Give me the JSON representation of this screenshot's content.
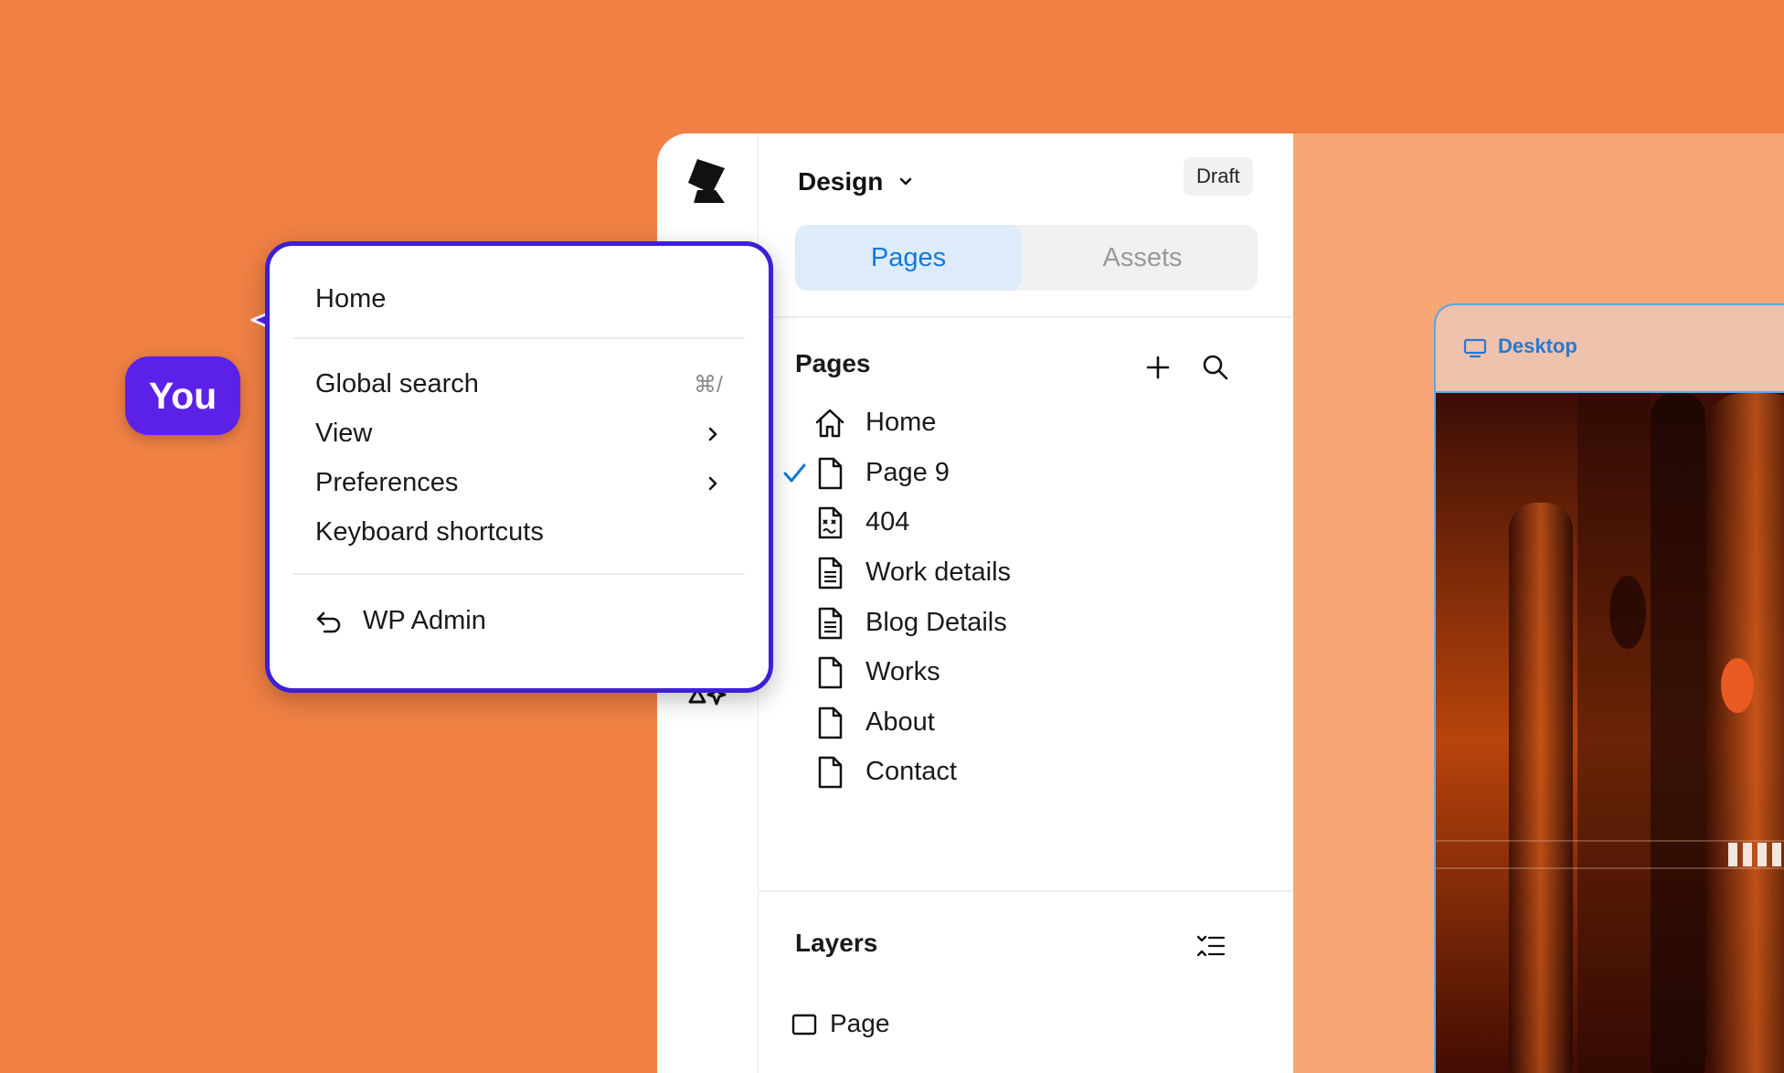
{
  "cursor": {
    "label": "You"
  },
  "menu": {
    "home": "Home",
    "global_search": "Global search",
    "global_search_shortcut": "⌘/",
    "view": "View",
    "preferences": "Preferences",
    "keyboard_shortcuts": "Keyboard shortcuts",
    "wp_admin": "WP Admin"
  },
  "header": {
    "mode": "Design",
    "status": "Draft",
    "tabs": [
      "Pages",
      "Assets"
    ]
  },
  "pages": {
    "title": "Pages",
    "items": [
      {
        "label": "Home",
        "icon": "home-icon",
        "selected": false
      },
      {
        "label": "Page 9",
        "icon": "page-icon",
        "selected": true
      },
      {
        "label": "404",
        "icon": "error-page-icon",
        "selected": false
      },
      {
        "label": "Work details",
        "icon": "template-page-icon",
        "selected": false
      },
      {
        "label": "Blog Details",
        "icon": "template-page-icon",
        "selected": false
      },
      {
        "label": "Works",
        "icon": "page-icon",
        "selected": false
      },
      {
        "label": "About",
        "icon": "page-icon",
        "selected": false
      },
      {
        "label": "Contact",
        "icon": "page-icon",
        "selected": false
      }
    ]
  },
  "layers": {
    "title": "Layers",
    "items": [
      {
        "label": "Page",
        "icon": "frame-icon"
      }
    ]
  },
  "canvas": {
    "breakpoint": "Desktop"
  },
  "colors": {
    "background": "#F08044",
    "canvas": "#F9A676",
    "accent_blue": "#1478D8",
    "menu_border": "#3D1FD8",
    "cursor_badge": "#5B21E8"
  }
}
